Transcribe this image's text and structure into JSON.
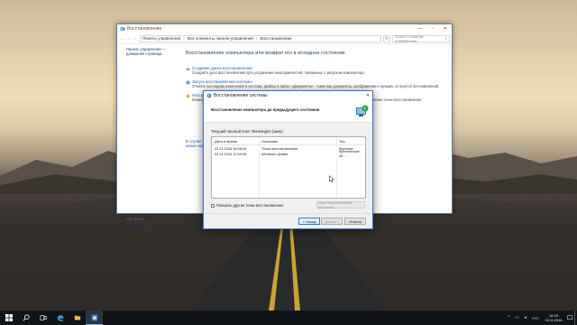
{
  "control_panel": {
    "title": "Восстановление",
    "breadcrumbs": [
      "Панель управления",
      "Все элементы панели управления",
      "Восстановление"
    ],
    "search_placeholder": "Поиск в панели управления",
    "sidebar_link_line1": "Панель управления —",
    "sidebar_link_line2": "домашняя страница",
    "see_also": "См. также",
    "history_link": "История файлов",
    "heading": "Восстановление компьютера или возврат его в исходное состояние",
    "items": [
      {
        "title": "Создание диска восстановления",
        "desc": "Создайте диск восстановления для устранения неисправностей, связанных с запуском компьютера."
      },
      {
        "title": "Запуск восстановления системы",
        "desc": "Отмена последних изменений в системе, файлы в папке «Документы», такие как документы, изображения и музыка, останутся без изменений."
      },
      {
        "title": "Настройка восстановления системы",
        "desc": "Изменение параметров восстановления системы, управление дисковым пространством, создание и удаление точек восстановления."
      }
    ],
    "note_line1": "В случае возникновения",
    "note_line2": "можно вернуть..."
  },
  "dialog": {
    "title": "Восстановление системы",
    "header": "Восстановление компьютера до предыдущего состояния",
    "timezone": "Текущий часовой пояс: Финляндия (зима)",
    "columns": [
      "Дата и время",
      "Описание",
      "Тип"
    ],
    "rows": [
      {
        "date": "03.11.2016 16:08:06",
        "desc": "Точка восстановления",
        "type": "Вручную"
      },
      {
        "date": "03.11.2016 10:00:06",
        "desc": "Windows Update",
        "type": "Критическое об..."
      }
    ],
    "checkbox_label": "Показать другие точки восстановления",
    "scan_button": "Поиск затрагиваемых программ",
    "back_button": "< Назад",
    "next_button": "Далее >",
    "cancel_button": "Отмена"
  },
  "taskbar": {
    "language": "РУС",
    "time": "16:15",
    "date": "03.11.2016"
  },
  "colors": {
    "accent": "#2a7cd5",
    "link": "#1a5fb4",
    "taskbar": "#101418"
  }
}
